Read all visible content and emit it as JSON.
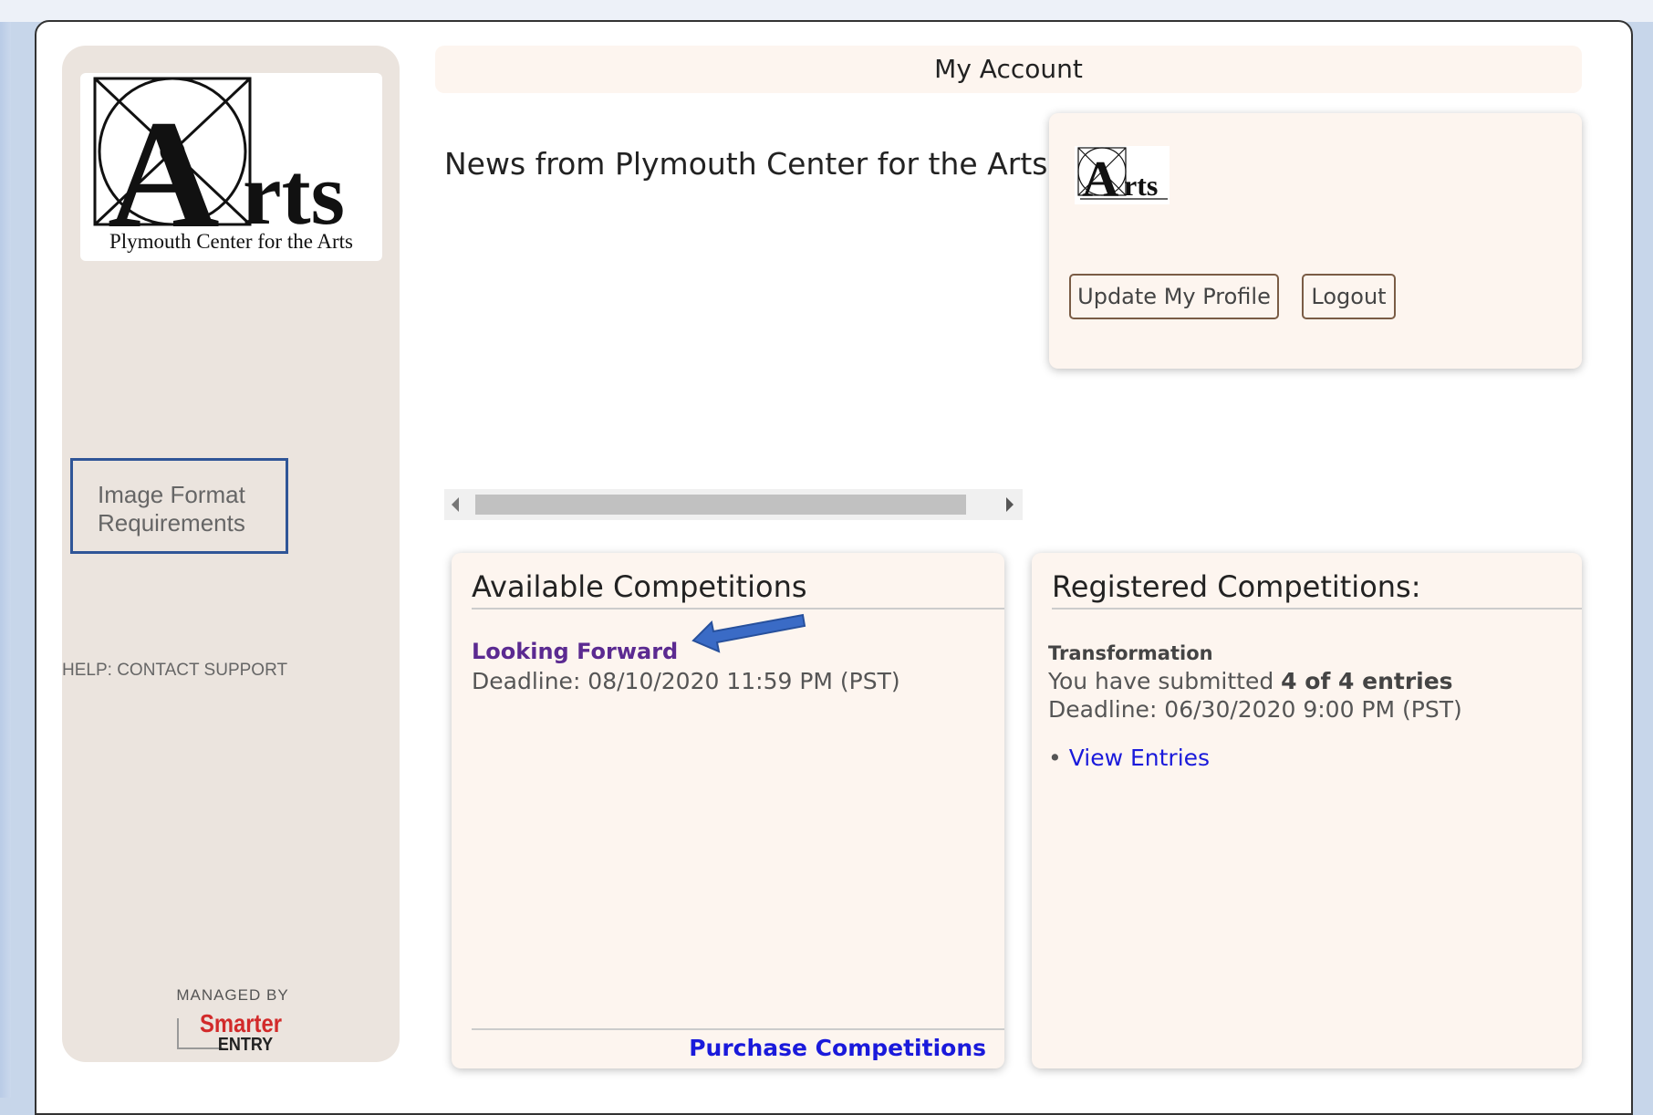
{
  "sidebar": {
    "logo_caption": "Plymouth Center for the Arts",
    "image_format_label": "Image Format Requirements",
    "help_label": "HELP: CONTACT SUPPORT",
    "managed_by": "MANAGED BY",
    "brand_line1": "Smarter",
    "brand_line2": "ENTRY"
  },
  "header": {
    "title": "My Account"
  },
  "news": {
    "heading": "News from Plymouth Center for the Arts"
  },
  "profile": {
    "update_label": "Update My Profile",
    "logout_label": "Logout"
  },
  "available": {
    "title": "Available Competitions",
    "item_name": "Looking Forward",
    "item_deadline": "Deadline: 08/10/2020 11:59 PM (PST)",
    "purchase_label": "Purchase Competitions"
  },
  "registered": {
    "title": "Registered Competitions:",
    "item_name": "Transformation",
    "submitted_prefix": "You have submitted ",
    "submitted_count": "4 of 4 entries",
    "item_deadline": "Deadline: 06/30/2020 9:00 PM (PST)",
    "bullet": "•",
    "view_label": "View Entries"
  },
  "colors": {
    "accent_border": "#2f5597",
    "link_purple": "#5b2a91",
    "link_blue": "#1a1adb",
    "brand_red": "#d22a2a",
    "annotation_arrow": "#3a6bc6"
  }
}
